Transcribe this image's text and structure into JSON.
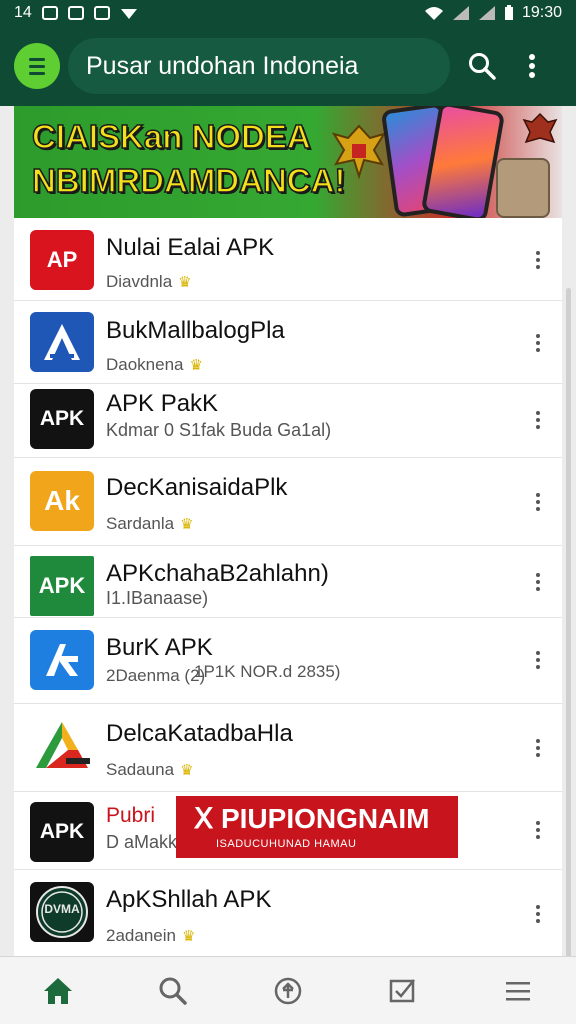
{
  "status_bar": {
    "left_text": "14",
    "time": "19:30"
  },
  "app_bar": {
    "title": "Pusar undohan Indoneia",
    "menu_icon": "menu-icon",
    "search_icon": "search-icon",
    "more_icon": "more-vert-icon"
  },
  "banner": {
    "line1": "CIAISKan NODEA",
    "line2": "NBIMRDAMDANCA!"
  },
  "apps": [
    {
      "title": "Nulai Ealai APK",
      "subtitle": "Diavdnla",
      "icon_text": "AP",
      "icon_color": "#d9141e"
    },
    {
      "title": "BukMallbalogPla",
      "subtitle": "Daoknena",
      "icon_text": "A",
      "icon_color": "#1e57b5"
    },
    {
      "title": "APK PakK",
      "subtitle": "Kdmar 0 S1fak Buda Ga1al)",
      "icon_text": "APK",
      "icon_color": "#121212"
    },
    {
      "title": "DecKanisaidaPlk",
      "subtitle": "Sardanla",
      "icon_text": "Ak",
      "icon_color": "#f0a51b"
    },
    {
      "title": "APKchahaB2ahlahn)",
      "subtitle": "I1.IBanaase)",
      "icon_text": "APK",
      "icon_color": "#1f8a3c"
    },
    {
      "title": "BurK APK",
      "subtitle": "2Daenma (2)",
      "subtitle_extra": "1P1K NOR.d 2835)",
      "icon_text": "R",
      "icon_color": "#1f7fe0"
    },
    {
      "title": "DelcaKatadbaHla",
      "subtitle": "Sadauna",
      "icon_text": "A",
      "icon_color": "#ffffff"
    },
    {
      "title": "Pubri",
      "subtitle": "D aMakk",
      "icon_text": "APK",
      "icon_color": "#121212"
    },
    {
      "title": "ApKShllah APK",
      "subtitle": "2adanein",
      "icon_text": "DVMA",
      "icon_color": "#111111"
    }
  ],
  "ad_banner": {
    "headline": "PIUPIONGNAIM",
    "tagline": "ISADUCUHUNAD HAMAU"
  },
  "bottom_nav": [
    {
      "name": "home",
      "icon": "home-icon",
      "active": true
    },
    {
      "name": "search",
      "icon": "search-icon",
      "active": false
    },
    {
      "name": "upload",
      "icon": "upload-icon",
      "active": false
    },
    {
      "name": "tasks",
      "icon": "checkbox-icon",
      "active": false
    },
    {
      "name": "menu",
      "icon": "menu-icon",
      "active": false
    }
  ],
  "colors": {
    "header": "#0f4a35",
    "accent": "#5fce32",
    "badge": "#d9b400",
    "ad": "#c8141c"
  }
}
